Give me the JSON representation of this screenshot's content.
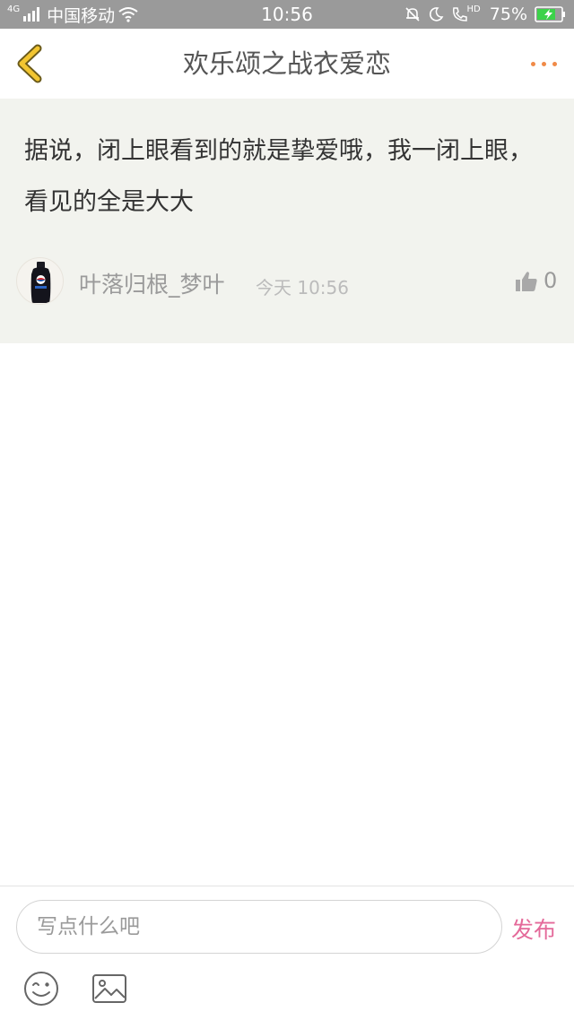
{
  "status_bar": {
    "network": "4G",
    "carrier": "中国移动",
    "time": "10:56",
    "hd_label": "HD",
    "battery": "75%"
  },
  "nav": {
    "title": "欢乐颂之战衣爱恋"
  },
  "post": {
    "text": "据说，闭上眼看到的就是挚爱哦，我一闭上眼，看见的全是大大",
    "author": "叶落归根_梦叶",
    "time": "今天 10:56",
    "likes": "0"
  },
  "composer": {
    "placeholder": "写点什么吧",
    "send_label": "发布"
  },
  "colors": {
    "accent_orange": "#f08a48",
    "back_arrow": "#f2c530",
    "send_pink": "#e46a9a",
    "post_bg": "#f2f3ee",
    "battery_green": "#3cd24a"
  }
}
